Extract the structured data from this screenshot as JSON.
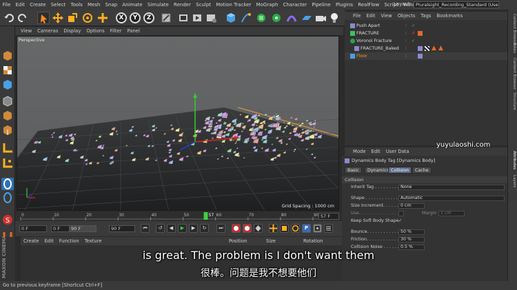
{
  "menu": [
    "File",
    "Edit",
    "Create",
    "Select",
    "Tools",
    "Mesh",
    "Snap",
    "Animate",
    "Simulate",
    "Render",
    "Sculpt",
    "Motion Tracker",
    "MoGraph",
    "Character",
    "Pipeline",
    "Plugins",
    "RealFlow",
    "Script",
    "Window"
  ],
  "layout": {
    "label": "Layout:",
    "value": "Pluralsight_Recording_Standard (User)"
  },
  "toolbar": {
    "x": "X",
    "y": "Y",
    "z": "Z"
  },
  "viewport": {
    "menu": [
      "View",
      "Cameras",
      "Display",
      "Options",
      "Filter",
      "Panel"
    ],
    "label": "Perspective",
    "grid_spacing": "Grid Spacing : 1000 cm"
  },
  "timeline": {
    "ticks": [
      "0",
      "10",
      "20",
      "30",
      "40",
      "50",
      "60",
      "70",
      "80",
      "90"
    ],
    "current_frame_marker": "57",
    "current_frame_field": "57 F",
    "start": "0 F",
    "preview_start": "0 F",
    "preview_end": "90 F",
    "end": "90 F"
  },
  "material_menu": [
    "Create",
    "Edit",
    "Function",
    "Texture"
  ],
  "coords_header": [
    "Position",
    "Size",
    "Rotation"
  ],
  "object_manager": {
    "menu": [
      "File",
      "Edit",
      "View",
      "Objects",
      "Tags",
      "Bookmarks"
    ],
    "objects": [
      {
        "name": "Push Apart",
        "color": "#c8c8c8"
      },
      {
        "name": "FRACTURE",
        "color": "#c8c8c8"
      },
      {
        "name": "Voronoi Fracture",
        "color": "#c8c8c8"
      },
      {
        "name": "FRACTURE_Baked",
        "color": "#c8c8c8"
      },
      {
        "name": "Floor",
        "color": "#f0a030"
      }
    ]
  },
  "attribute_manager": {
    "menu": [
      "Mode",
      "Edit",
      "User Data"
    ],
    "title": "Dynamics Body Tag [Dynamics Body]",
    "tabs": [
      "Basic",
      "Dynamics",
      "Collision",
      "Cache"
    ],
    "active_tab": "Collision",
    "section": "Collision",
    "rows": [
      {
        "label": "Inherit Tag . . . . . . . . . . . . .",
        "value": "None"
      },
      {
        "label": "Shape . . . . . . . . . . . . . . . . .",
        "value": "Automatic"
      },
      {
        "label": "Size Increment. . . . . . . . .",
        "value": "0 cm"
      },
      {
        "label": "Use. . . . . . . . . . . . . . . .",
        "value": "",
        "extra_label": "Margin",
        "extra_value": "1 cm"
      },
      {
        "label": "Keep Soft Body Shape",
        "value": "✓"
      },
      {
        "label": "Bounce. . . . . . . . . . . . . . .",
        "value": "50 %"
      },
      {
        "label": "Friction. . . . . . . . . . . . . .",
        "value": "30 %"
      },
      {
        "label": "Collision Noise . . . . . . . .",
        "value": "0.5 %"
      }
    ]
  },
  "right_tabs": [
    "Content Browser",
    "Takes",
    "Content Browser",
    "Structure",
    "Attributes",
    "Layers"
  ],
  "status": "Go to previous keyframe [Shortcut Ctrl+F]",
  "subtitle_en": "is great. The problem is I don't want them",
  "subtitle_zh": "很棒。问题是我不想要他们",
  "watermark": "yuyulaoshi.com",
  "maxon": "MAXON CINEMA 4D"
}
